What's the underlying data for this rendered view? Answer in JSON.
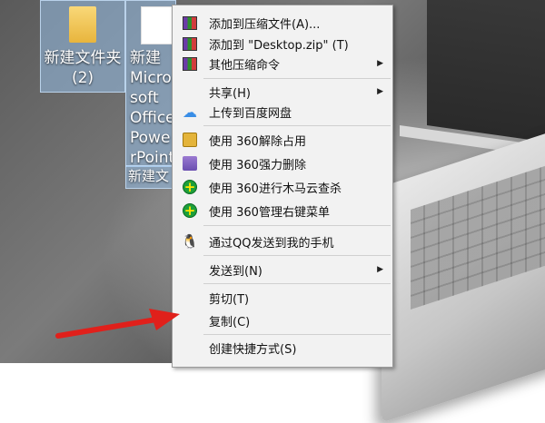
{
  "desktop": {
    "icons": [
      {
        "label_line1": "新建文件夹",
        "label_line2": "(2)"
      },
      {
        "label_line1": "新建 Microsoft Office PowerPoint 演示文稿"
      },
      {
        "label_line1": "新建文本"
      }
    ]
  },
  "context_menu": {
    "items": [
      {
        "label": "添加到压缩文件(A)...",
        "icon": "winrar-icon"
      },
      {
        "label": "添加到 \"Desktop.zip\" (T)",
        "icon": "winrar-icon"
      },
      {
        "label": "其他压缩命令",
        "icon": "winrar-icon",
        "submenu": true
      },
      {
        "label": "共享(H)",
        "submenu": true
      },
      {
        "label": "上传到百度网盘",
        "icon": "baidu-cloud-icon"
      },
      {
        "label": "使用 360解除占用",
        "icon": "unlock-360-icon"
      },
      {
        "label": "使用 360强力删除",
        "icon": "shredder-360-icon"
      },
      {
        "label": "使用 360进行木马云查杀",
        "icon": "scan-360-icon"
      },
      {
        "label": "使用 360管理右键菜单",
        "icon": "manage-360-icon"
      },
      {
        "label": "通过QQ发送到我的手机",
        "icon": "qq-icon"
      },
      {
        "label": "发送到(N)",
        "submenu": true
      },
      {
        "label": "剪切(T)"
      },
      {
        "label": "复制(C)"
      },
      {
        "label": "创建快捷方式(S)"
      }
    ],
    "submenu_arrow": "▶"
  },
  "annotation": {
    "color": "#e0201b"
  }
}
